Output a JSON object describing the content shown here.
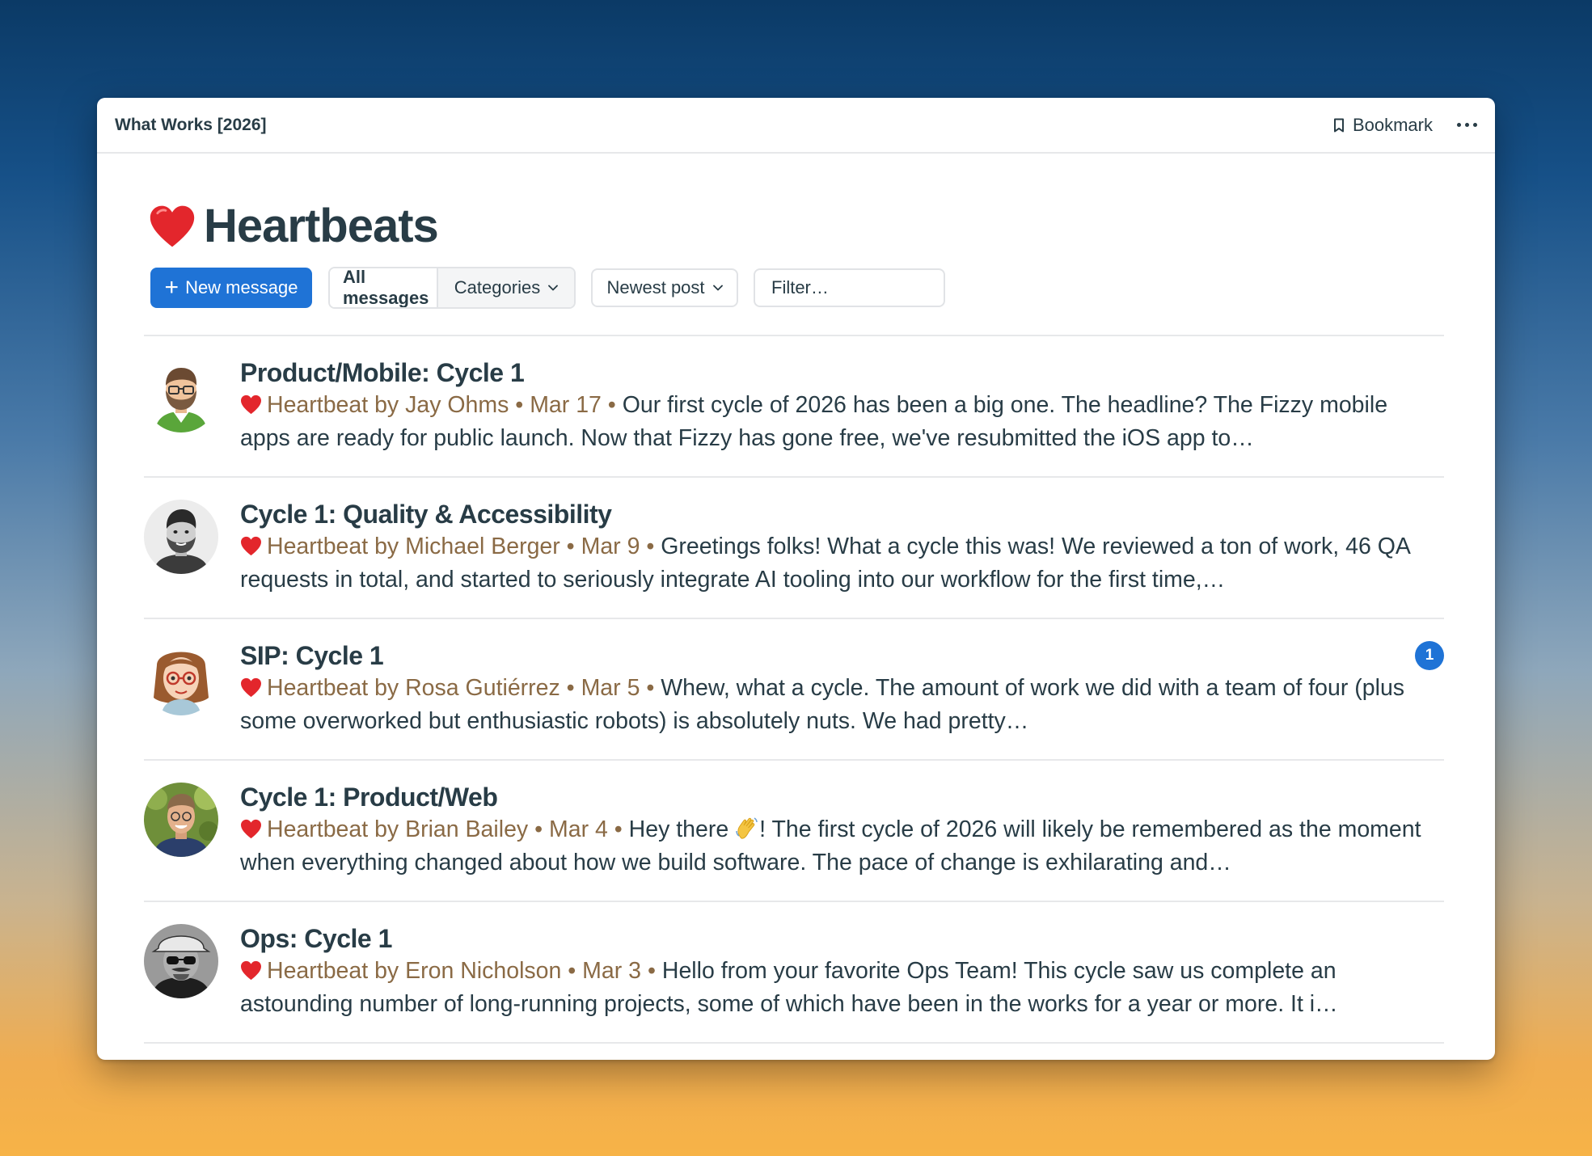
{
  "window": {
    "breadcrumb": "What Works [2026]",
    "bookmark_label": "Bookmark",
    "more_icon": "ellipsis-icon"
  },
  "page": {
    "title": "Heartbeats",
    "title_icon": "red-heart-icon"
  },
  "toolbar": {
    "new_message_label": "New message",
    "tab_all_messages": "All messages",
    "tab_categories": "Categories",
    "sort_label": "Newest post",
    "filter_placeholder": "Filter…"
  },
  "colors": {
    "accent": "#1f73d6",
    "meta_text": "#8a6a45",
    "heading_text": "#283c46"
  },
  "messages": [
    {
      "title": "Product/Mobile: Cycle 1",
      "meta": "Heartbeat by Jay Ohms • Mar 17 •",
      "excerpt": "Our first cycle of 2026 has been a big one. The headline? The Fizzy mobile apps are ready for public launch.  Now that Fizzy has gone free, we've resubmitted the iOS app to…",
      "avatar": "avatar-jay-ohms"
    },
    {
      "title": "Cycle 1: Quality & Accessibility",
      "meta": "Heartbeat by Michael Berger • Mar 9 •",
      "excerpt": "Greetings folks! What a cycle this was! We reviewed a ton of work, 46 QA requests in total, and started to seriously integrate AI tooling into our workflow for the first time,…",
      "avatar": "avatar-michael-berger"
    },
    {
      "title": "SIP: Cycle 1",
      "meta": "Heartbeat by Rosa Gutiérrez • Mar 5 •",
      "excerpt": "Whew, what a cycle. The amount of work we did with a team of four (plus some overworked but enthusiastic robots) is absolutely nuts. We had pretty…",
      "avatar": "avatar-rosa-gutierrez",
      "unread_count": "1"
    },
    {
      "title": "Cycle 1: Product/Web",
      "meta": "Heartbeat by Brian Bailey • Mar 4 •",
      "excerpt_before": "Hey there ",
      "excerpt_after": "! The first cycle of 2026 will likely be remembered as the moment when everything changed about how we build software. The pace of change is exhilarating and…",
      "avatar": "avatar-brian-bailey",
      "inline_icon": "waving-hand-icon"
    },
    {
      "title": "Ops: Cycle 1",
      "meta": "Heartbeat by Eron Nicholson • Mar 3 •",
      "excerpt": "Hello from your favorite Ops Team!  This cycle saw us complete an astounding number of long-running projects, some of which have been in the works for a year or more.  It i…",
      "avatar": "avatar-eron-nicholson"
    }
  ]
}
